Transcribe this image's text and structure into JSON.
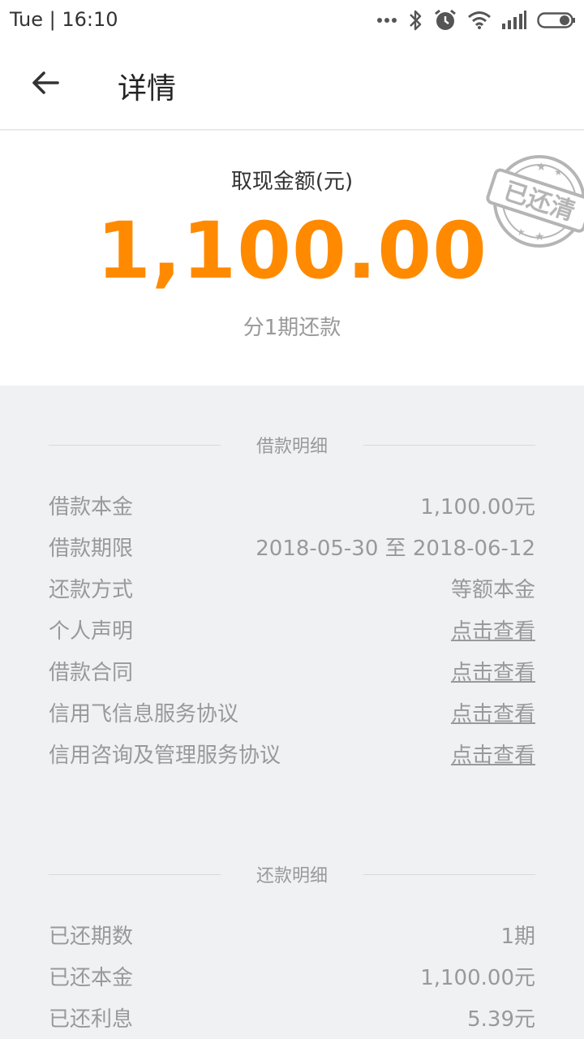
{
  "status_bar": {
    "time": "Tue | 16:10",
    "icons": [
      "dots-icon",
      "bluetooth-icon",
      "alarm-icon",
      "wifi-icon",
      "signal-icon",
      "battery-icon"
    ]
  },
  "header": {
    "title": "详情"
  },
  "summary": {
    "label": "取现金额(元)",
    "amount": "1,100.00",
    "subtitle": "分1期还款",
    "stamp_text": "已还清",
    "accent_color": "#ff8a00"
  },
  "loan_details": {
    "title": "借款明细",
    "rows": [
      {
        "label": "借款本金",
        "value": "1,100.00元"
      },
      {
        "label": "借款期限",
        "value": "2018-05-30 至 2018-06-12"
      },
      {
        "label": "还款方式",
        "value": "等额本金"
      },
      {
        "label": "个人声明",
        "value": "点击查看"
      },
      {
        "label": "借款合同",
        "value": "点击查看"
      },
      {
        "label": "信用飞信息服务协议",
        "value": "点击查看"
      },
      {
        "label": "信用咨询及管理服务协议",
        "value": "点击查看"
      }
    ]
  },
  "repay_details": {
    "title": "还款明细",
    "rows": [
      {
        "label": "已还期数",
        "value": "1期"
      },
      {
        "label": "已还本金",
        "value": "1,100.00元"
      },
      {
        "label": "已还利息",
        "value": "5.39元"
      }
    ]
  }
}
